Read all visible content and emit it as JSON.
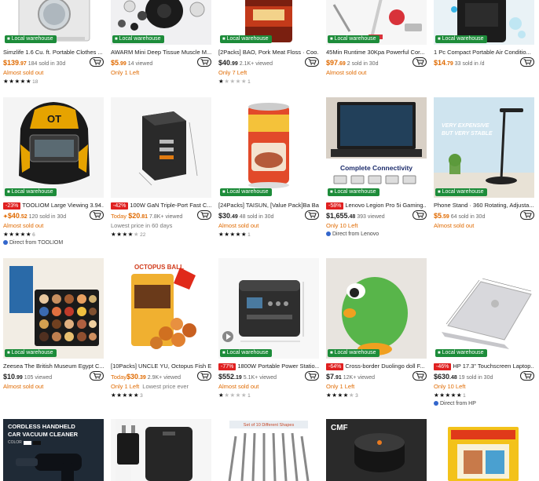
{
  "warehouse_label": "Local warehouse",
  "row1": [
    {
      "title": "Simzlife 1.6 Cu. ft. Portable Clothes ...",
      "price_main": "$139",
      "price_cents": ".97",
      "price_color": "orange",
      "sold": "184 sold in 30d",
      "status": "Almost sold out",
      "stars": 5,
      "rating_count": "18"
    },
    {
      "title": "AWARM Mini Deep Tissue Muscle M...",
      "price_main": "$5",
      "price_cents": ".99",
      "price_color": "orange",
      "sold": "14 viewed",
      "status": "Only 1 Left",
      "stars": 0,
      "rating_count": ""
    },
    {
      "title": "[2Packs] BAO, Pork Meat Floss · Coo...",
      "price_main": "$40",
      "price_cents": ".99",
      "price_color": "dark",
      "sold": "2.1K+ viewed",
      "status": "Only 7 Left",
      "stars": 1,
      "rating_count": "1"
    },
    {
      "title": "45Min Runtime 30Kpa Powerful Cor...",
      "price_main": "$97",
      "price_cents": ".69",
      "price_color": "orange",
      "sold": "2 sold in 30d",
      "status": "Almost sold out",
      "stars": 0,
      "rating_count": ""
    },
    {
      "title": "1 Pc Compact Portable Air Conditio...",
      "price_main": "$14",
      "price_cents": ".79",
      "price_color": "orange",
      "sold": "33 sold in /d",
      "status": "",
      "stars": 0,
      "rating_count": ""
    }
  ],
  "row2": [
    {
      "discount": "-23%",
      "title": "TOOLIOM Large Viewing 3.94...",
      "price_main": "$40",
      "price_cents": ".52",
      "price_color": "orange",
      "price_prefix": "✦",
      "sold": "120 sold in 30d",
      "status": "Almost sold out",
      "status_extra": "",
      "stars": 5,
      "rating_count": "6",
      "direct": "Direct from TOOLIOM"
    },
    {
      "discount": "-42%",
      "title": "100W GaN Triple-Port Fast C...",
      "today": "Today",
      "price_main": "$20",
      "price_cents": ".81",
      "price_color": "orange",
      "sold": "7.8K+ viewed",
      "status": "Lowest price in 60 days",
      "status_grey": true,
      "stars": 4,
      "rating_count": "22",
      "direct": ""
    },
    {
      "discount": "",
      "title": "[24Packs] TAISUN, [Value Pack]Ba Ba...",
      "price_main": "$30",
      "price_cents": ".49",
      "price_color": "dark",
      "sold": "48 sold in 30d",
      "status": "Almost sold out",
      "status_extra": "",
      "stars": 5,
      "rating_count": "1",
      "direct": ""
    },
    {
      "discount": "-58%",
      "title": "Lenovo Legion Pro 5i Gaming...",
      "price_main": "$1,655",
      "price_cents": ".48",
      "price_color": "dark",
      "sold": "393 viewed",
      "status": "Only 10 Left",
      "status_extra": "",
      "stars": 0,
      "rating_count": "",
      "direct": "Direct from Lenovo"
    },
    {
      "discount": "",
      "title": "Phone Stand · 360 Rotating, Adjusta...",
      "price_main": "$5",
      "price_cents": ".59",
      "price_color": "orange",
      "sold": "64 sold in 30d",
      "status": "Almost sold out",
      "status_extra": "",
      "stars": 0,
      "rating_count": "",
      "direct": ""
    }
  ],
  "row3": [
    {
      "discount": "",
      "title": "Zeesea The British Museum Egypt C...",
      "price_main": "$10",
      "price_cents": ".99",
      "price_color": "dark",
      "sold": "105 viewed",
      "status": "Almost sold out",
      "status_extra": "",
      "stars": 0,
      "rating_count": "",
      "direct": ""
    },
    {
      "discount": "",
      "title": "[10Packs] UNCLE YU, Octopus Fish E...",
      "today": "Today",
      "price_main": "$30",
      "price_cents": ".39",
      "price_color": "orange",
      "sold": "2.9K+ viewed",
      "status": "Only 1 Left",
      "status_extra": "Lowest price ever",
      "stars": 5,
      "rating_count": "3",
      "direct": ""
    },
    {
      "discount": "-77%",
      "title": "1800W Portable Power Statio...",
      "price_main": "$552",
      "price_cents": ".19",
      "price_color": "dark",
      "sold": "5.1K+ viewed",
      "status": "Almost sold out",
      "status_extra": "",
      "stars": 1,
      "rating_count": "1",
      "direct": ""
    },
    {
      "discount": "-64%",
      "title": "Cross-border Duolingo doll F...",
      "price_main": "$7",
      "price_cents": ".91",
      "price_color": "dark",
      "sold": "12K+ viewed",
      "status": "Only 1 Left",
      "status_extra": "",
      "stars": 4,
      "rating_count": "3",
      "direct": ""
    },
    {
      "discount": "-46%",
      "title": "HP 17.3\" Touchscreen Laptop...",
      "price_main": "$630",
      "price_cents": ".48",
      "price_color": "dark",
      "sold": "19 sold in 30d",
      "status": "Only 10 Left",
      "status_extra": "",
      "stars": 5,
      "rating_count": "1",
      "direct": "Direct from HP"
    }
  ],
  "row4_images": {
    "vacuum_line1": "CORDLESS HANDHELD",
    "vacuum_line2": "CAR VACUUM CLEANER",
    "vacuum_line3": "COLOR",
    "burr_banner": "Set of 10 Different Shapes",
    "cmf_logo": "CMF"
  },
  "image_text": {
    "ot_logo": "OT",
    "laptop_banner": "Complete Connectivity",
    "stand_line1": "VERY EXPENSIVE",
    "stand_line2": "BUT VERY STABLE",
    "octopus_banner": "OCTOPUS BALL",
    "duo_eye": ""
  },
  "colors": {
    "warehouse_green": "#1d8c3a",
    "discount_red": "#e02020",
    "price_orange": "#e06a00"
  },
  "icons": {
    "cart": "cart-icon",
    "warehouse": "truck-icon",
    "direct": "verified-icon"
  }
}
